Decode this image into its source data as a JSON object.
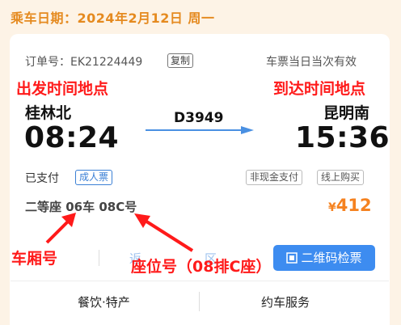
{
  "travel_date": "乘车日期：2024年2月12日 周一",
  "order": {
    "label": "订单号：EK21224449",
    "copy_label": "复制"
  },
  "validity": "车票当日当次有效",
  "annotations": {
    "departure": "出发时间地点",
    "arrival": "到达时间地点",
    "car": "车厢号",
    "seat": "座位号（08排C座）"
  },
  "trip": {
    "from_station": "桂林北",
    "to_station": "昆明南",
    "depart_time": "08:24",
    "arrive_time": "15:36",
    "train_no": "D3949"
  },
  "status": "已支付",
  "ticket_type": "成人票",
  "tags": [
    "非现金支付",
    "线上购买"
  ],
  "seat_info": "二等座 06车 08C号",
  "price": {
    "symbol": "¥",
    "amount": "412"
  },
  "actions": {
    "partial_left": "返",
    "partial_mid": "区",
    "qr_button": "二维码检票"
  },
  "bottom_menu": [
    "餐饮·特产",
    "约车服务"
  ],
  "colors": {
    "accent_orange": "#f58220",
    "link_blue": "#3d8cf0",
    "annotation_red": "#ff1a1a"
  }
}
